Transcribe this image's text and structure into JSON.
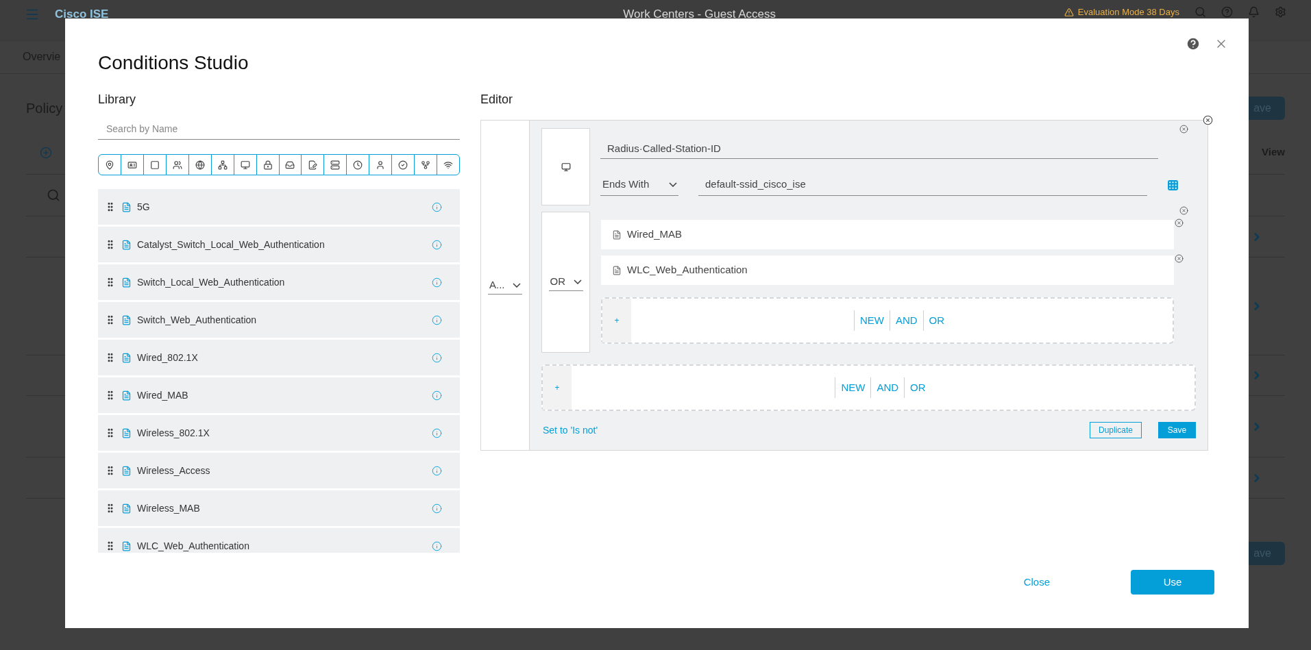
{
  "background": {
    "brand": "Cisco ISE",
    "page_title": "Work Centers - Guest Access",
    "eval_notice": "Evaluation Mode 38 Days",
    "tab": "Overvie",
    "section_title": "Policy",
    "save_buttons": [
      "ave",
      "ave"
    ],
    "view_label": "View"
  },
  "dialog": {
    "title": "Conditions Studio",
    "library": {
      "heading": "Library",
      "search": {
        "placeholder": "Search by Name"
      },
      "items": [
        {
          "label": "5G"
        },
        {
          "label": "Catalyst_Switch_Local_Web_Authentication"
        },
        {
          "label": "Switch_Local_Web_Authentication"
        },
        {
          "label": "Switch_Web_Authentication"
        },
        {
          "label": "Wired_802.1X"
        },
        {
          "label": "Wired_MAB"
        },
        {
          "label": "Wireless_802.1X"
        },
        {
          "label": "Wireless_Access"
        },
        {
          "label": "Wireless_MAB"
        },
        {
          "label": "WLC_Web_Authentication"
        }
      ]
    },
    "editor": {
      "heading": "Editor",
      "root_operator": "A...",
      "conditions": [
        {
          "kind": "attribute",
          "attribute": "Radius·Called-Station-ID",
          "operator": "Ends With",
          "value": "default-ssid_cisco_ise"
        },
        {
          "kind": "group",
          "operator": "OR",
          "children": [
            {
              "label": "Wired_MAB"
            },
            {
              "label": "WLC_Web_Authentication"
            }
          ],
          "add": {
            "plus": "+",
            "actions": [
              "NEW",
              "AND",
              "OR"
            ]
          }
        }
      ],
      "add": {
        "plus": "+",
        "actions": [
          "NEW",
          "AND",
          "OR"
        ]
      },
      "negate_link": "Set to 'Is not'",
      "duplicate": "Duplicate",
      "save": "Save"
    },
    "footer": {
      "close": "Close",
      "use": "Use"
    }
  }
}
